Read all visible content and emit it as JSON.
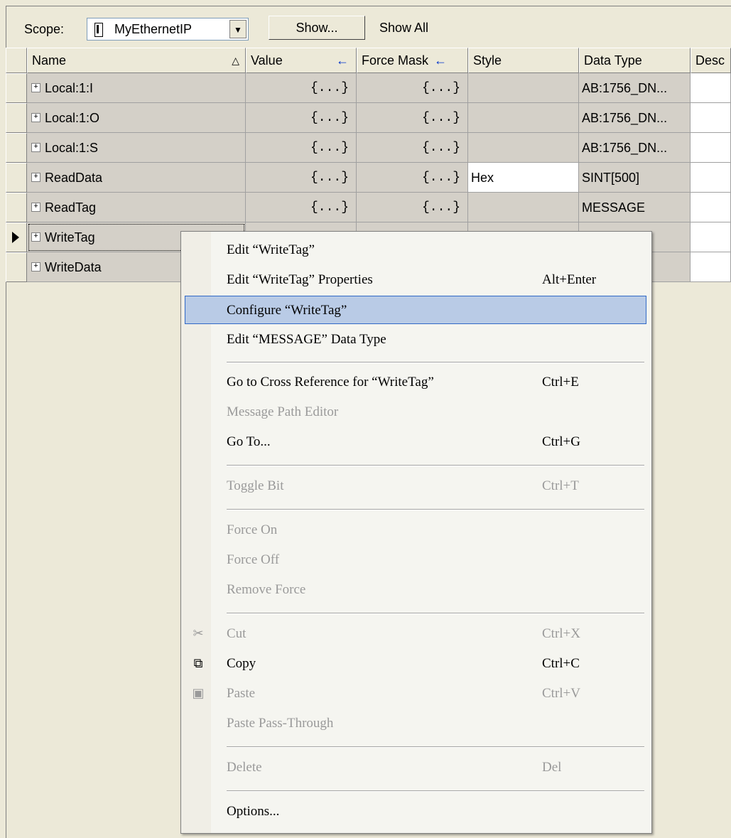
{
  "toolbar": {
    "scope_label": "Scope:",
    "scope_value": "MyEthernetIP",
    "show_button": "Show...",
    "show_all": "Show All"
  },
  "columns": {
    "name": "Name",
    "value": "Value",
    "force_mask": "Force Mask",
    "style": "Style",
    "data_type": "Data Type",
    "description": "Desc"
  },
  "rows": [
    {
      "name": "Local:1:I",
      "value": "{...}",
      "force_mask": "{...}",
      "style": "",
      "data_type": "AB:1756_DN..."
    },
    {
      "name": "Local:1:O",
      "value": "{...}",
      "force_mask": "{...}",
      "style": "",
      "data_type": "AB:1756_DN..."
    },
    {
      "name": "Local:1:S",
      "value": "{...}",
      "force_mask": "{...}",
      "style": "",
      "data_type": "AB:1756_DN..."
    },
    {
      "name": "ReadData",
      "value": "{...}",
      "force_mask": "{...}",
      "style": "Hex",
      "data_type": "SINT[500]"
    },
    {
      "name": "ReadTag",
      "value": "{...}",
      "force_mask": "{...}",
      "style": "",
      "data_type": "MESSAGE"
    },
    {
      "name": "WriteTag",
      "value": "",
      "force_mask": "",
      "style": "",
      "data_type": ""
    },
    {
      "name": "WriteData",
      "value": "",
      "force_mask": "",
      "style": "",
      "data_type": ""
    }
  ],
  "context_menu": {
    "items": [
      {
        "label": "Edit “WriteTag”",
        "shortcut": ""
      },
      {
        "label": "Edit “WriteTag” Properties",
        "shortcut": "Alt+Enter"
      },
      {
        "label": "Configure “WriteTag”",
        "shortcut": ""
      },
      {
        "label": "Edit “MESSAGE” Data Type",
        "shortcut": ""
      },
      {
        "label": "Go to Cross Reference for “WriteTag”",
        "shortcut": "Ctrl+E"
      },
      {
        "label": "Message Path Editor",
        "shortcut": ""
      },
      {
        "label": "Go To...",
        "shortcut": "Ctrl+G"
      },
      {
        "label": "Toggle Bit",
        "shortcut": "Ctrl+T"
      },
      {
        "label": "Force On",
        "shortcut": ""
      },
      {
        "label": "Force Off",
        "shortcut": ""
      },
      {
        "label": "Remove Force",
        "shortcut": ""
      },
      {
        "label": "Cut",
        "shortcut": "Ctrl+X"
      },
      {
        "label": "Copy",
        "shortcut": "Ctrl+C"
      },
      {
        "label": "Paste",
        "shortcut": "Ctrl+V"
      },
      {
        "label": "Paste Pass-Through",
        "shortcut": ""
      },
      {
        "label": "Delete",
        "shortcut": "Del"
      },
      {
        "label": "Options...",
        "shortcut": ""
      }
    ]
  },
  "icons": {
    "cut": "scissors-icon",
    "copy": "copy-icon",
    "paste": "paste-icon"
  },
  "colors": {
    "highlight": "#b9cbe6",
    "highlight_border": "#3169c6",
    "row_bg": "#d4d0c8"
  }
}
